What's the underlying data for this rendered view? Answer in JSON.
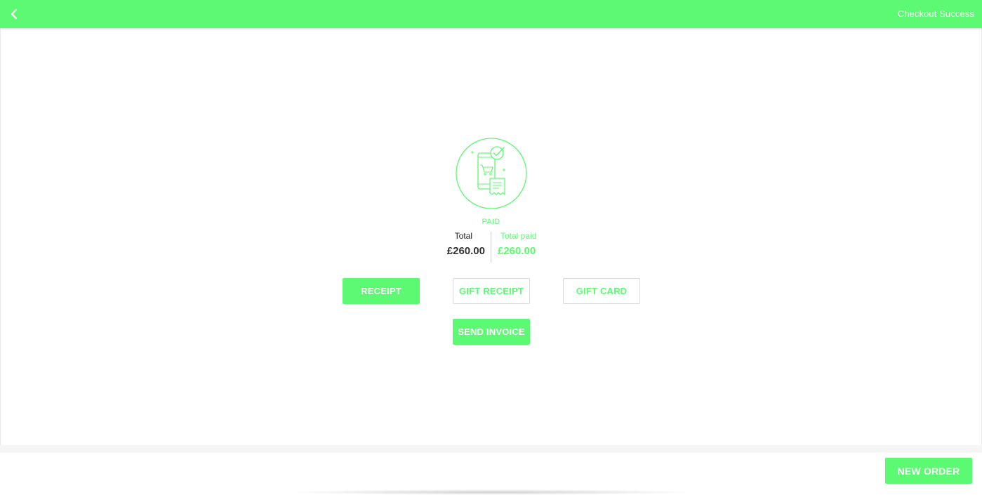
{
  "header": {
    "title": "Checkout Success",
    "back_icon": "chevron-left-icon"
  },
  "status": {
    "icon": "phone-cart-receipt-check-icon",
    "label": "PAID"
  },
  "totals": {
    "total_label": "Total",
    "total_amount": "£260.00",
    "paid_label": "Total paid",
    "paid_amount": "£260.00"
  },
  "actions": {
    "receipt_label": "RECEIPT",
    "gift_receipt_label": "GIFT RECEIPT",
    "gift_card_label": "GIFT CARD",
    "send_invoice_label": "SEND INVOICE"
  },
  "footer": {
    "new_order_label": "NEW ORDER"
  },
  "colors": {
    "accent": "#5cfa72",
    "text_dark": "#333333",
    "border": "#d9d9d9"
  }
}
